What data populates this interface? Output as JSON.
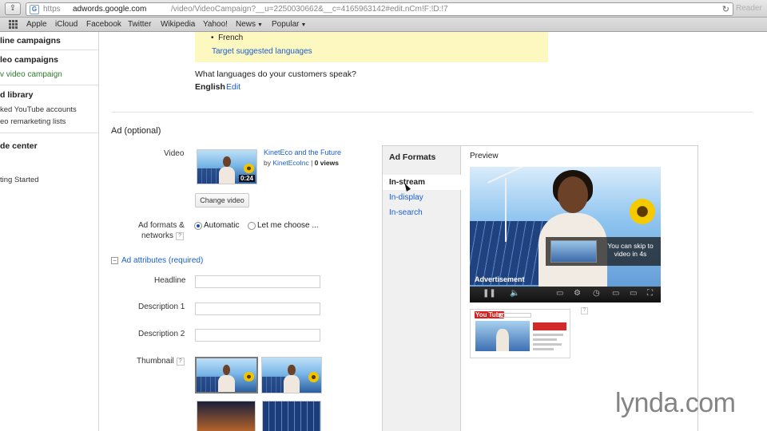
{
  "browser": {
    "url_scheme": "https",
    "url_host": "adwords.google.com",
    "url_path": "/video/VideoCampaign?__u=2250030662&__c=4165963142#edit.nCm!F:!D:!7",
    "reader_label": "Reader",
    "bookmarks": [
      {
        "label": "Apple"
      },
      {
        "label": "iCloud"
      },
      {
        "label": "Facebook"
      },
      {
        "label": "Twitter"
      },
      {
        "label": "Wikipedia"
      },
      {
        "label": "Yahoo!"
      },
      {
        "label": "News",
        "dropdown": true
      },
      {
        "label": "Popular",
        "dropdown": true
      }
    ]
  },
  "sidebar": {
    "items": [
      {
        "label": "line campaigns",
        "style": "bold"
      },
      {
        "label": "leo campaigns",
        "style": "bold"
      },
      {
        "label": "v video campaign",
        "style": "green"
      },
      {
        "label": "d library",
        "style": "bold"
      },
      {
        "label": "ked YouTube accounts",
        "style": "plain"
      },
      {
        "label": "eo remarketing lists",
        "style": "plain"
      },
      {
        "label": "de center",
        "style": "bold"
      },
      {
        "label": "ting Started",
        "style": "plain"
      }
    ]
  },
  "languages": {
    "bullet_item": "French",
    "suggest_link": "Target suggested languages",
    "question": "What languages do your customers speak?",
    "value": "English",
    "edit_link": "Edit"
  },
  "ad": {
    "section_title": "Ad (optional)",
    "video_label": "Video",
    "video_title": "KinetEco and the Future",
    "video_by": "by",
    "video_channel": "KinetEcoInc",
    "video_views": "0 views",
    "video_duration": "0:24",
    "change_video_label": "Change video",
    "formats_label_line1": "Ad formats &",
    "formats_label_line2": "networks",
    "help_glyph": "?",
    "radio_automatic": "Automatic",
    "radio_choose": "Let me choose ...",
    "radio_selected": "Automatic",
    "attributes_toggle": "−",
    "attributes_link": "Ad attributes (required)",
    "headline_label": "Headline",
    "headline_value": "",
    "description1_label": "Description 1",
    "description1_value": "",
    "description2_label": "Description 2",
    "description2_value": "",
    "thumbnail_label": "Thumbnail"
  },
  "formats_panel": {
    "heading": "Ad Formats",
    "items": [
      {
        "label": "In-stream",
        "active": true
      },
      {
        "label": "In-display",
        "active": false
      },
      {
        "label": "In-search",
        "active": false
      }
    ],
    "preview_label": "Preview",
    "skip_text": "You can skip to video in 4s",
    "ad_label": "Advertisement",
    "mini_logo_you": "You",
    "mini_logo_tube": "Tube"
  },
  "watermark": "lynda.com",
  "colors": {
    "link": "#1a5fd0",
    "highlight_box": "#fdf7c0",
    "nav_green": "#2b7c2b",
    "nav_panel": "#f0f0f0"
  },
  "icons": {
    "share": "share-icon",
    "reload": "reload-icon",
    "apps": "apps-grid-icon",
    "cursor": "mouse-cursor-icon"
  }
}
